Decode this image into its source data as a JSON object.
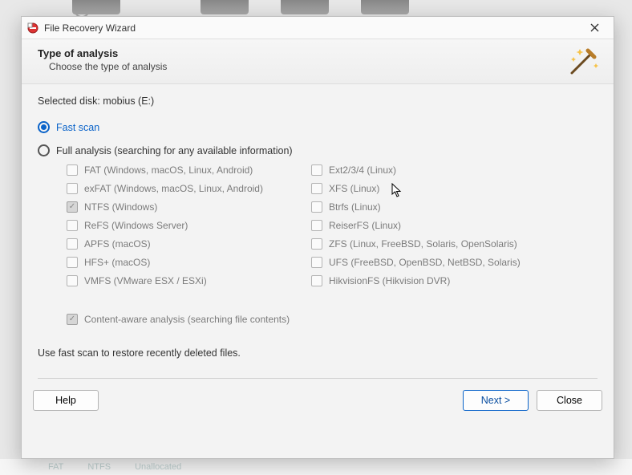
{
  "titlebar": {
    "title": "File Recovery Wizard"
  },
  "header": {
    "title": "Type of analysis",
    "subtitle": "Choose the type of analysis"
  },
  "selected_disk_label": "Selected disk: mobius (E:)",
  "radio_fast": "Fast scan",
  "radio_full": "Full analysis (searching for any available information)",
  "fs_left": [
    {
      "label": "FAT (Windows, macOS, Linux, Android)",
      "checked": false
    },
    {
      "label": "exFAT (Windows, macOS, Linux, Android)",
      "checked": false
    },
    {
      "label": "NTFS (Windows)",
      "checked": true
    },
    {
      "label": "ReFS (Windows Server)",
      "checked": false
    },
    {
      "label": "APFS (macOS)",
      "checked": false
    },
    {
      "label": "HFS+ (macOS)",
      "checked": false
    },
    {
      "label": "VMFS (VMware ESX / ESXi)",
      "checked": false
    }
  ],
  "fs_right": [
    {
      "label": "Ext2/3/4 (Linux)",
      "checked": false
    },
    {
      "label": "XFS (Linux)",
      "checked": false
    },
    {
      "label": "Btrfs (Linux)",
      "checked": false
    },
    {
      "label": "ReiserFS (Linux)",
      "checked": false
    },
    {
      "label": "ZFS (Linux, FreeBSD, Solaris, OpenSolaris)",
      "checked": false
    },
    {
      "label": "UFS (FreeBSD, OpenBSD, NetBSD, Solaris)",
      "checked": false
    },
    {
      "label": "HikvisionFS (Hikvision DVR)",
      "checked": false
    }
  ],
  "content_aware": {
    "label": "Content-aware analysis (searching file contents)",
    "checked": true
  },
  "hint": "Use fast scan to restore recently deleted files.",
  "buttons": {
    "help": "Help",
    "next": "Next >",
    "close": "Close"
  },
  "bg": {
    "a": "FAT",
    "b": "NTFS",
    "c": "Unallocated"
  }
}
